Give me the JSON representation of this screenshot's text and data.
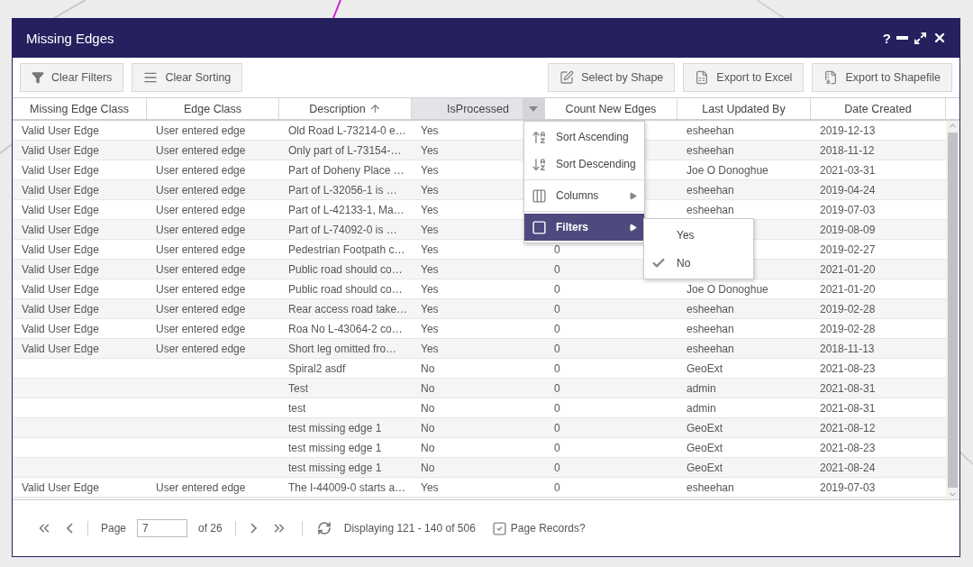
{
  "window": {
    "title": "Missing Edges",
    "controls": [
      {
        "kind": "help",
        "label": "?"
      },
      {
        "kind": "minimize"
      },
      {
        "kind": "maximize"
      },
      {
        "kind": "close"
      }
    ]
  },
  "toolbar": {
    "left": [
      {
        "kind": "filter",
        "label": "Clear Filters"
      },
      {
        "kind": "sorting",
        "label": "Clear Sorting"
      }
    ],
    "right": [
      {
        "kind": "shape",
        "label": "Select by Shape"
      },
      {
        "kind": "excel",
        "label": "Export to Excel"
      },
      {
        "kind": "shapefile",
        "label": "Export to Shapefile"
      }
    ]
  },
  "table": {
    "columns": [
      {
        "label": "Missing Edge Class",
        "sorted_ascending": false,
        "menu_open": false
      },
      {
        "label": "Edge Class",
        "sorted_ascending": false,
        "menu_open": false
      },
      {
        "label": "Description",
        "sorted_ascending": true,
        "menu_open": false
      },
      {
        "label": "IsProcessed",
        "sorted_ascending": false,
        "menu_open": true
      },
      {
        "label": "Count New Edges",
        "sorted_ascending": false,
        "menu_open": false
      },
      {
        "label": "Last Updated By",
        "sorted_ascending": false,
        "menu_open": false
      },
      {
        "label": "Date Created",
        "sorted_ascending": false,
        "menu_open": false
      }
    ],
    "rows": [
      [
        "Valid User Edge",
        "User entered edge",
        "Old Road L-73214-0 e…",
        "Yes",
        null,
        "esheehan",
        "2019-12-13"
      ],
      [
        "Valid User Edge",
        "User entered edge",
        "Only part of L-73154-…",
        "Yes",
        null,
        "esheehan",
        "2018-11-12"
      ],
      [
        "Valid User Edge",
        "User entered edge",
        "Part of Doheny Place …",
        "Yes",
        null,
        "Joe O Donoghue",
        "2021-03-31"
      ],
      [
        "Valid User Edge",
        "User entered edge",
        "Part of L-32056-1 is …",
        "Yes",
        null,
        "esheehan",
        "2019-04-24"
      ],
      [
        "Valid User Edge",
        "User entered edge",
        "Part of L-42133-1, Ma…",
        "Yes",
        null,
        "esheehan",
        "2019-07-03"
      ],
      [
        "Valid User Edge",
        "User entered edge",
        "Part of L-74092-0 is …",
        "Yes",
        null,
        null,
        "2019-08-09"
      ],
      [
        "Valid User Edge",
        "User entered edge",
        "Pedestrian Footpath c…",
        "Yes",
        "0",
        null,
        "2019-02-27"
      ],
      [
        "Valid User Edge",
        "User entered edge",
        "Public road should co…",
        "Yes",
        "0",
        null,
        "2021-01-20"
      ],
      [
        "Valid User Edge",
        "User entered edge",
        "Public road should co…",
        "Yes",
        "0",
        "Joe O Donoghue",
        "2021-01-20"
      ],
      [
        "Valid User Edge",
        "User entered edge",
        "Rear access road take…",
        "Yes",
        "0",
        "esheehan",
        "2019-02-28"
      ],
      [
        "Valid User Edge",
        "User entered edge",
        "Roa No L-43064-2 co…",
        "Yes",
        "0",
        "esheehan",
        "2019-02-28"
      ],
      [
        "Valid User Edge",
        "User entered edge",
        "Short leg omitted fro…",
        "Yes",
        "0",
        "esheehan",
        "2018-11-13"
      ],
      [
        null,
        null,
        "Spiral2 asdf",
        "No",
        "0",
        "GeoExt",
        "2021-08-23"
      ],
      [
        null,
        null,
        "Test",
        "No",
        "0",
        "admin",
        "2021-08-31"
      ],
      [
        null,
        null,
        "test",
        "No",
        "0",
        "admin",
        "2021-08-31"
      ],
      [
        null,
        null,
        "test missing edge 1",
        "No",
        "0",
        "GeoExt",
        "2021-08-12"
      ],
      [
        null,
        null,
        "test missing edge 1",
        "No",
        "0",
        "GeoExt",
        "2021-08-23"
      ],
      [
        null,
        null,
        "test missing edge 1",
        "No",
        "0",
        "GeoExt",
        "2021-08-24"
      ],
      [
        "Valid User Edge",
        "User entered edge",
        "The I-44009-0 starts a…",
        "Yes",
        "0",
        "esheehan",
        "2019-07-03"
      ]
    ]
  },
  "column_menu": {
    "items": [
      {
        "kind": "sort_asc",
        "label": "Sort Ascending",
        "selected": false,
        "submenu": false
      },
      {
        "kind": "sort_desc",
        "label": "Sort Descending",
        "selected": false,
        "submenu": false
      },
      {
        "kind": "columns",
        "label": "Columns",
        "selected": false,
        "submenu": true
      },
      {
        "kind": "filters",
        "label": "Filters",
        "selected": true,
        "submenu": true
      }
    ],
    "filter_options": [
      {
        "label": "Yes",
        "checked": false
      },
      {
        "label": "No",
        "checked": true
      }
    ]
  },
  "pager": {
    "page_label": "Page",
    "page": "7",
    "of": "of 26",
    "display": "Displaying 121 - 140 of 506",
    "page_records": {
      "label": "Page Records?",
      "checked": true
    }
  }
}
